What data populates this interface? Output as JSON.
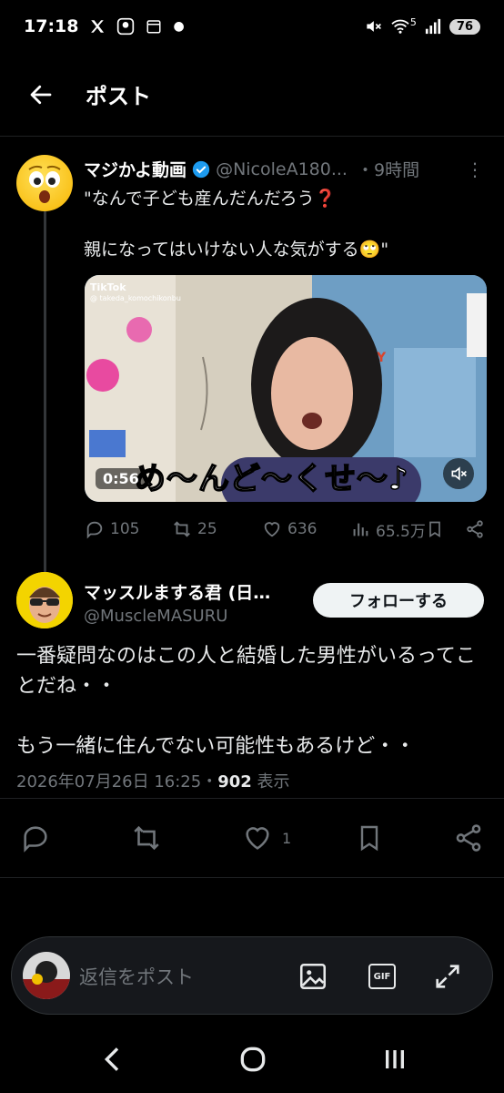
{
  "status_bar": {
    "time": "17:18",
    "battery": "76",
    "signal_label": "5"
  },
  "header": {
    "title": "ポスト"
  },
  "tweet": {
    "author_name": "マジかよ動画",
    "handle": "@NicoleA180...",
    "time": "・9時間",
    "text_line1": "\"なんで子ども産んだんだろう❓",
    "text_line2": "親になってはいけない人な気がする🙄\"",
    "media": {
      "tiktok_label": "TikTok",
      "tiktok_user": "@ takeda_komochikonbu",
      "duration": "0:56",
      "caption": "め〜んど〜くせ〜♪"
    },
    "metrics": {
      "replies": "105",
      "reposts": "25",
      "likes": "636",
      "views": "65.5万"
    }
  },
  "reply": {
    "author_name": "マッスルまする君 (日…",
    "handle": "@MuscleMASURU",
    "follow_label": "フォローする",
    "text_line1": "一番疑問なのはこの人と結婚した男性がいるってことだね・・",
    "text_line2": "もう一緒に住んでない可能性もあるけど・・",
    "timestamp": "2026年07月26日 16:25・",
    "views_count": "902",
    "views_label": " 表示",
    "likes": "1"
  },
  "composer": {
    "placeholder": "返信をポスト",
    "gif_label": "GIF"
  },
  "colors": {
    "background": "#000000",
    "secondary_text": "#71767b",
    "verified": "#1d9bf0"
  }
}
